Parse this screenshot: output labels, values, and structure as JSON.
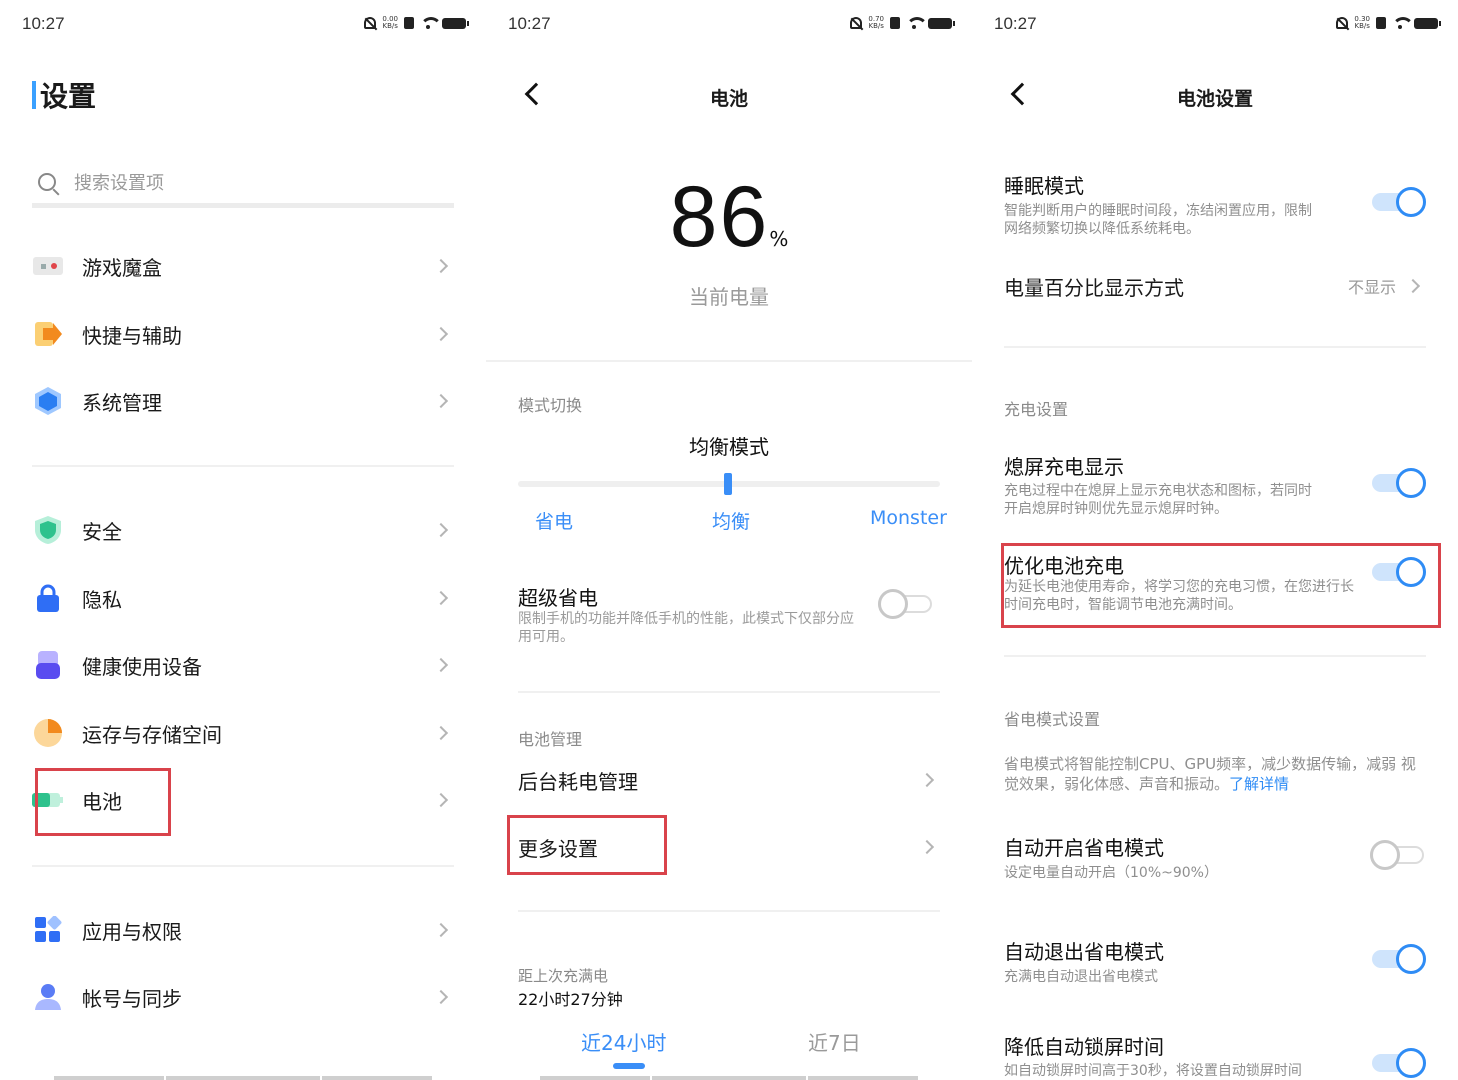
{
  "status": [
    {
      "time": "10:27",
      "speed_top": "0.00",
      "speed_unit": "KB/s"
    },
    {
      "time": "10:27",
      "speed_top": "0.70",
      "speed_unit": "KB/s"
    },
    {
      "time": "10:27",
      "speed_top": "0.30",
      "speed_unit": "KB/s"
    }
  ],
  "settings": {
    "title": "设置",
    "search_placeholder": "搜索设置项",
    "items": [
      {
        "label": "游戏魔盒"
      },
      {
        "label": "快捷与辅助"
      },
      {
        "label": "系统管理"
      },
      {
        "label": "安全"
      },
      {
        "label": "隐私"
      },
      {
        "label": "健康使用设备"
      },
      {
        "label": "运存与存储空间"
      },
      {
        "label": "电池"
      },
      {
        "label": "应用与权限"
      },
      {
        "label": "帐号与同步"
      }
    ]
  },
  "battery": {
    "title": "电池",
    "percent": "86",
    "percent_unit": "%",
    "percent_caption": "当前电量",
    "mode_section": "模式切换",
    "current_mode": "均衡模式",
    "modes": [
      "省电",
      "均衡",
      "Monster"
    ],
    "super_save_title": "超级省电",
    "super_save_desc": "限制手机的功能并降低手机的性能，此模式下仅部分应用可用。",
    "manage_section": "电池管理",
    "background_mgmt": "后台耗电管理",
    "more_settings": "更多设置",
    "since_full_label": "距上次充满电",
    "since_full_value": "22小时27分钟",
    "tabs": [
      "近24小时",
      "近7日"
    ]
  },
  "battery_settings": {
    "title": "电池设置",
    "sleep_title": "睡眠模式",
    "sleep_desc": "智能判断用户的睡眠时间段，冻结闲置应用，限制网络频繁切换以降低系统耗电。",
    "pct_display_title": "电量百分比显示方式",
    "pct_display_value": "不显示",
    "charge_section": "充电设置",
    "screenoff_title": "熄屏充电显示",
    "screenoff_desc": "充电过程中在熄屏上显示充电状态和图标，若同时开启熄屏时钟则优先显示熄屏时钟。",
    "optimize_title": "优化电池充电",
    "optimize_desc": "为延长电池使用寿命，将学习您的充电习惯，在您进行长时间充电时，智能调节电池充满时间。",
    "powersave_section": "省电模式设置",
    "powersave_desc": "省电模式将智能控制CPU、GPU频率，减少数据传输，减弱 视觉效果，弱化体感、声音和振动。",
    "powersave_link": "了解详情",
    "auto_on_title": "自动开启省电模式",
    "auto_on_desc": "设定电量自动开启（10%~90%）",
    "auto_off_title": "自动退出省电模式",
    "auto_off_desc": "充满电自动退出省电模式",
    "lock_title": "降低自动锁屏时间",
    "lock_desc": "如自动锁屏时间高于30秒，将设置自动锁屏时间"
  },
  "colors": {
    "accent": "#2f8cf5",
    "highlight": "#d9434b"
  }
}
